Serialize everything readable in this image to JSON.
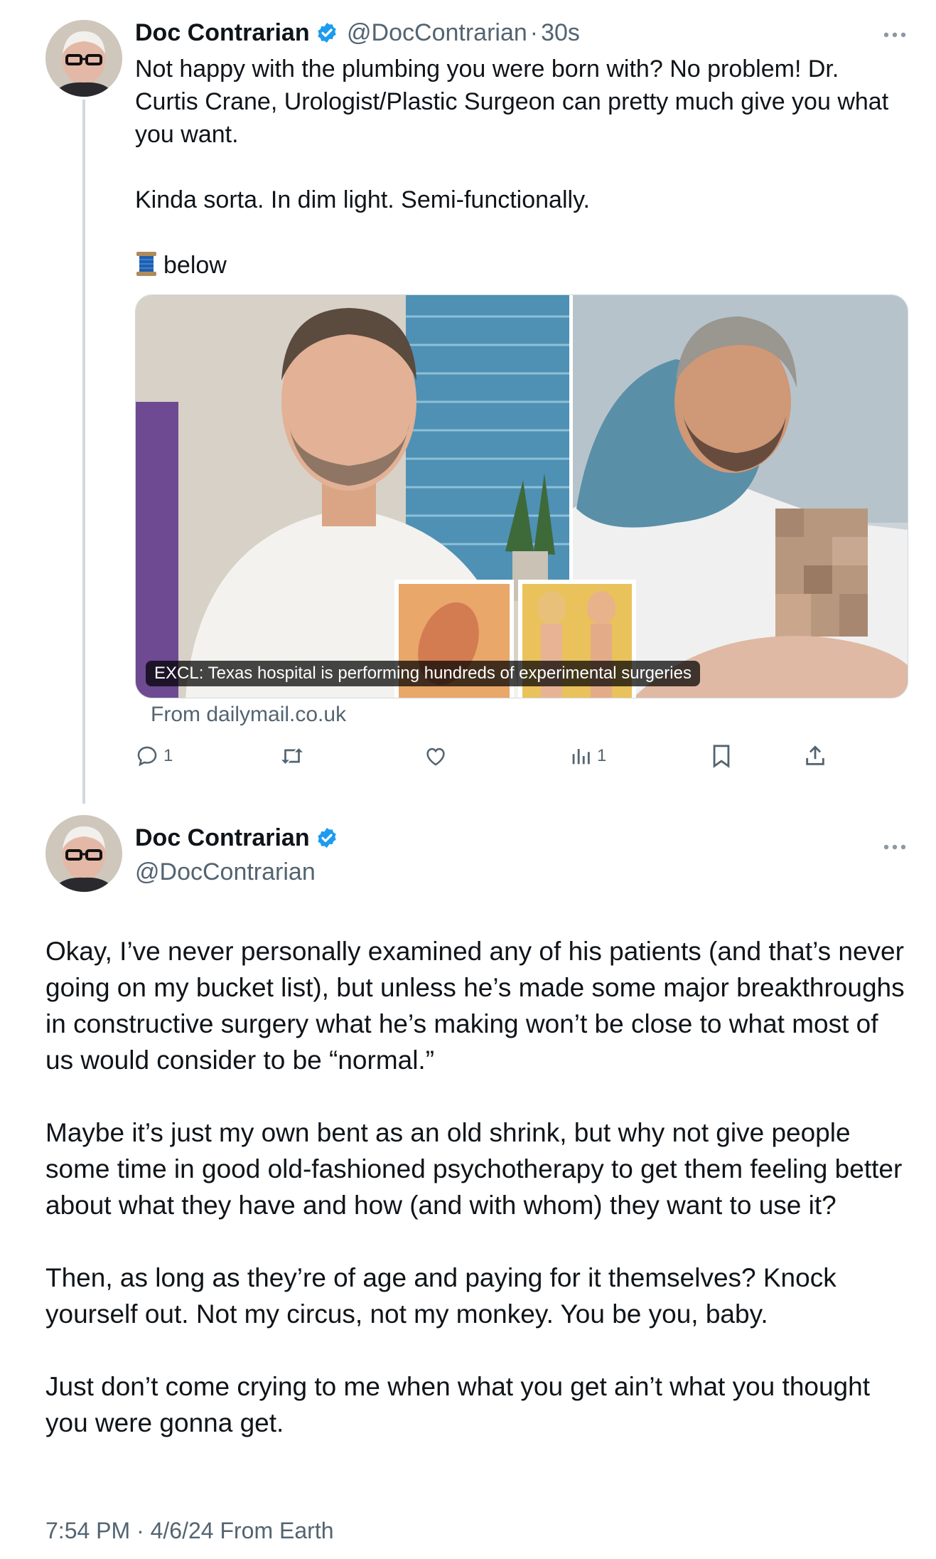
{
  "tweet1": {
    "author_name": "Doc Contrarian",
    "author_handle": "@DocContrarian",
    "separator": "·",
    "time": "30s",
    "body": "Not happy with the plumbing you were born with? No problem! Dr. Curtis Crane, Urologist/Plastic Surgeon can pretty much give you what you want.\n\nKinda sorta. In dim light. Semi-functionally.",
    "thread_word": "below",
    "card": {
      "caption": "EXCL: Texas hospital is performing hundreds of experimental surgeries",
      "source": "From dailymail.co.uk"
    },
    "actions": {
      "replies": "1",
      "views": "1"
    }
  },
  "tweet2": {
    "author_name": "Doc Contrarian",
    "author_handle": "@DocContrarian",
    "body": "Okay, I’ve never personally examined any of his patients (and that’s never going on my bucket list), but unless he’s made some major breakthroughs in constructive surgery what he’s making won’t be close to what most of us would consider to be “normal.”\n\nMaybe it’s just my own bent as an old shrink, but why not give people some time in good old-fashioned psychotherapy to get them feeling better about what they have and how (and with whom) they want to use it?\n\nThen, as long as they’re of age and paying for it themselves? Knock yourself out. Not my circus, not my monkey. You be you, baby.\n\nJust don’t come crying to me when what you get ain’t what you thought you were gonna get.",
    "meta": "7:54 PM · 4/6/24 From Earth"
  },
  "colors": {
    "verified_blue": "#1d9bf0",
    "secondary_text": "#536471",
    "thread_line": "#cfd9de"
  },
  "icons": [
    "verified-badge-icon",
    "more-icon",
    "reply-icon",
    "retweet-icon",
    "like-icon",
    "views-icon",
    "bookmark-icon",
    "share-icon",
    "spool-of-thread-icon"
  ]
}
